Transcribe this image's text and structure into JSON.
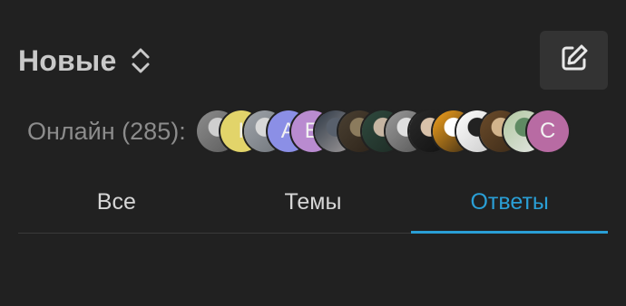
{
  "header": {
    "title": "Новые",
    "sort_icon": "sort-up-down-icon",
    "compose_icon": "edit-pencil-icon"
  },
  "online": {
    "label": "Онлайн (285):",
    "avatars": [
      {
        "kind": "photo",
        "colors": [
          "#8d8d8d",
          "#cfcfcf",
          "#5a5a5a"
        ]
      },
      {
        "kind": "letter",
        "letter": "I",
        "color": "#e2d46a"
      },
      {
        "kind": "photo",
        "colors": [
          "#9fa4aa",
          "#d8d8d8",
          "#6f747a"
        ]
      },
      {
        "kind": "letter",
        "letter": "A",
        "color": "#8b8fe6"
      },
      {
        "kind": "letter",
        "letter": "E",
        "color": "#b98bd0"
      },
      {
        "kind": "photo",
        "colors": [
          "#2c3744",
          "#58606c",
          "#a6a0a0"
        ]
      },
      {
        "kind": "photo",
        "colors": [
          "#4a4032",
          "#8b7b5d",
          "#2c2218"
        ]
      },
      {
        "kind": "photo",
        "colors": [
          "#2f4a3e",
          "#c6b5a2",
          "#1d2a24"
        ]
      },
      {
        "kind": "photo",
        "colors": [
          "#9a9a9a",
          "#e0e0e0",
          "#555555"
        ]
      },
      {
        "kind": "photo",
        "colors": [
          "#2a2a2a",
          "#d9c2aa",
          "#111111"
        ]
      },
      {
        "kind": "photo",
        "colors": [
          "#f4a21c",
          "#ffffff",
          "#3a2a15"
        ]
      },
      {
        "kind": "photo",
        "colors": [
          "#ffffff",
          "#222222",
          "#c9c9c9"
        ]
      },
      {
        "kind": "photo",
        "colors": [
          "#6b4b2a",
          "#d2b48c",
          "#3b2a18"
        ]
      },
      {
        "kind": "photo",
        "colors": [
          "#b0c8a0",
          "#5f8a63",
          "#e6e6e6"
        ]
      },
      {
        "kind": "letter",
        "letter": "C",
        "color": "#b86ba3"
      }
    ]
  },
  "tabs": [
    {
      "label": "Все",
      "active": false
    },
    {
      "label": "Темы",
      "active": false
    },
    {
      "label": "Ответы",
      "active": true
    }
  ],
  "colors": {
    "background": "#212121",
    "accent": "#2a9fd6"
  }
}
